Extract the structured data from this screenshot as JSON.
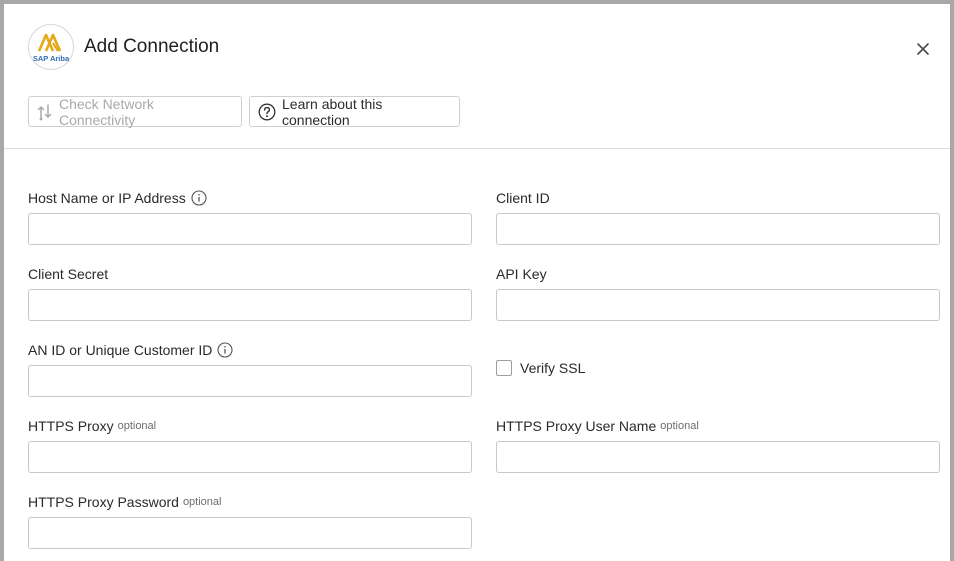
{
  "dialog": {
    "title": "Add Connection",
    "logo_text": "SAP Ariba",
    "close_icon": "close-icon",
    "colors": {
      "logo_gold": "#e6a817",
      "logo_blue": "#2f6db3",
      "disabled_text": "#a9a9a9"
    }
  },
  "toolbar": {
    "check_network_label": "Check Network Connectivity",
    "check_network_icon": "network-icon",
    "learn_label": "Learn about this connection",
    "learn_icon": "question-circle-icon"
  },
  "form": {
    "host": {
      "label": "Host Name or IP Address",
      "value": "",
      "info_icon": "info-icon"
    },
    "client_id": {
      "label": "Client ID",
      "value": ""
    },
    "client_secret": {
      "label": "Client Secret",
      "value": ""
    },
    "api_key": {
      "label": "API Key",
      "value": ""
    },
    "an_id": {
      "label": "AN ID or Unique Customer ID",
      "value": "",
      "info_icon": "info-icon"
    },
    "verify_ssl": {
      "label": "Verify SSL",
      "checked": false
    },
    "https_proxy": {
      "label": "HTTPS Proxy",
      "optional": "optional",
      "value": ""
    },
    "https_proxy_user": {
      "label": "HTTPS Proxy User Name",
      "optional": "optional",
      "value": ""
    },
    "https_proxy_password": {
      "label": "HTTPS Proxy Password",
      "optional": "optional",
      "value": ""
    }
  }
}
